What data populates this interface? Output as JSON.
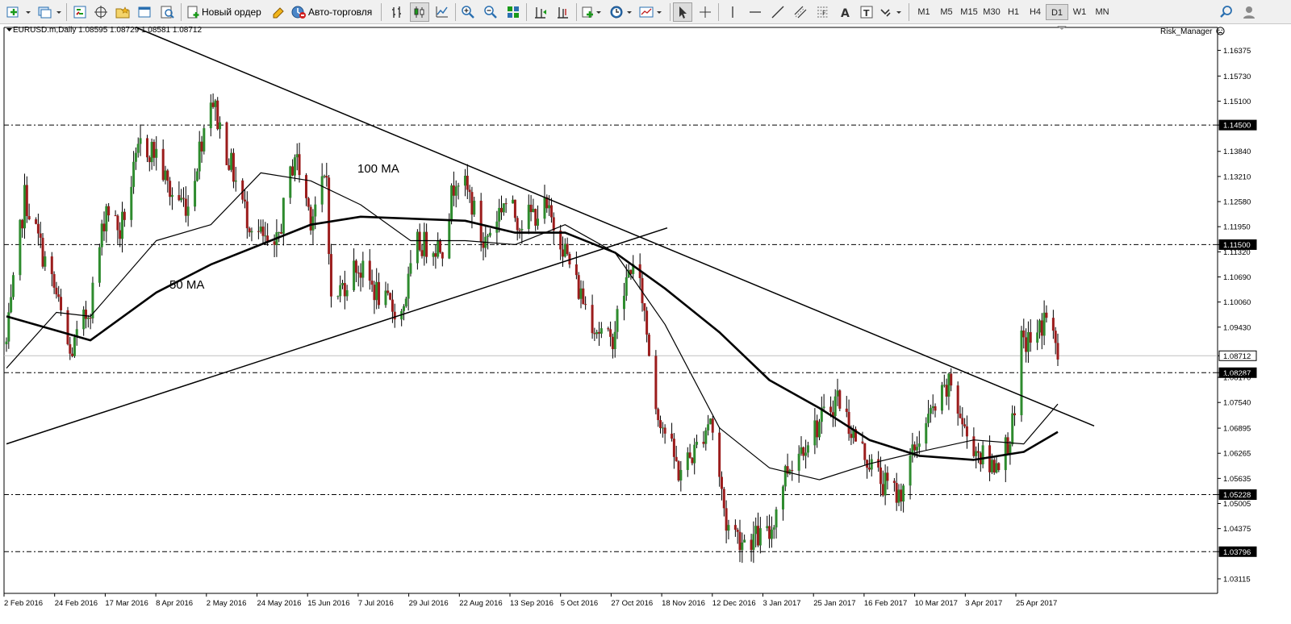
{
  "toolbar": {
    "new_order_label": "Новый ордер",
    "auto_trading_label": "Авто-торговля",
    "timeframes": [
      "M1",
      "M5",
      "M15",
      "M30",
      "H1",
      "H4",
      "D1",
      "W1",
      "MN"
    ],
    "active_timeframe": "D1"
  },
  "chart": {
    "header": "EURUSD.m,Daily  1.08595 1.08729 1.08581 1.08712",
    "expert_label": "Risk_Manager",
    "annotations": {
      "ma100": "100 MA",
      "ma50": "50 MA"
    },
    "price_labels": [
      "1.16375",
      "1.15730",
      "1.15100",
      "1.14500",
      "1.13840",
      "1.13210",
      "1.12580",
      "1.11950",
      "1.11500",
      "1.11320",
      "1.10690",
      "1.10060",
      "1.09430",
      "1.08712",
      "1.08287",
      "1.08170",
      "1.07540",
      "1.06895",
      "1.06265",
      "1.05635",
      "1.05228",
      "1.05005",
      "1.04375",
      "1.03796",
      "1.03115"
    ],
    "date_labels": [
      "2 Feb 2016",
      "24 Feb 2016",
      "17 Mar 2016",
      "8 Apr 2016",
      "2 May 2016",
      "24 May 2016",
      "15 Jun 2016",
      "7 Jul 2016",
      "29 Jul 2016",
      "22 Aug 2016",
      "13 Sep 2016",
      "5 Oct 2016",
      "27 Oct 2016",
      "18 Nov 2016",
      "12 Dec 2016",
      "3 Jan 2017",
      "25 Jan 2017",
      "16 Feb 2017",
      "10 Mar 2017",
      "3 Apr 2017",
      "25 Apr 2017"
    ],
    "colors": {
      "bull": "#2e8b2e",
      "bear": "#9b1c1c",
      "line": "#000000",
      "bid": "#c0c0c0"
    }
  },
  "chart_data": {
    "type": "candlestick",
    "symbol": "EURUSD.m",
    "timeframe": "Daily",
    "ylim": [
      1.0275,
      1.1695
    ],
    "x_range": [
      "2016-02-02",
      "2017-05-10"
    ],
    "horizontal_levels": [
      1.145,
      1.115,
      1.08287,
      1.05228,
      1.03796
    ],
    "current_price": 1.08712,
    "anchors": [
      {
        "date": "2016-02-02",
        "price": 1.09
      },
      {
        "date": "2016-02-10",
        "price": 1.127
      },
      {
        "date": "2016-02-24",
        "price": 1.102
      },
      {
        "date": "2016-03-01",
        "price": 1.087
      },
      {
        "date": "2016-03-10",
        "price": 1.1
      },
      {
        "date": "2016-03-17",
        "price": 1.125
      },
      {
        "date": "2016-03-23",
        "price": 1.118
      },
      {
        "date": "2016-04-01",
        "price": 1.14
      },
      {
        "date": "2016-04-08",
        "price": 1.138
      },
      {
        "date": "2016-04-14",
        "price": 1.128
      },
      {
        "date": "2016-04-22",
        "price": 1.125
      },
      {
        "date": "2016-05-02",
        "price": 1.153
      },
      {
        "date": "2016-05-08",
        "price": 1.14
      },
      {
        "date": "2016-05-18",
        "price": 1.122
      },
      {
        "date": "2016-05-30",
        "price": 1.112
      },
      {
        "date": "2016-06-08",
        "price": 1.138
      },
      {
        "date": "2016-06-15",
        "price": 1.122
      },
      {
        "date": "2016-06-22",
        "price": 1.132
      },
      {
        "date": "2016-06-24",
        "price": 1.1
      },
      {
        "date": "2016-07-05",
        "price": 1.11
      },
      {
        "date": "2016-07-18",
        "price": 1.1
      },
      {
        "date": "2016-07-25",
        "price": 1.098
      },
      {
        "date": "2016-08-01",
        "price": 1.115
      },
      {
        "date": "2016-08-12",
        "price": 1.115
      },
      {
        "date": "2016-08-18",
        "price": 1.133
      },
      {
        "date": "2016-08-24",
        "price": 1.127
      },
      {
        "date": "2016-08-30",
        "price": 1.115
      },
      {
        "date": "2016-09-08",
        "price": 1.126
      },
      {
        "date": "2016-09-15",
        "price": 1.121
      },
      {
        "date": "2016-09-26",
        "price": 1.124
      },
      {
        "date": "2016-10-03",
        "price": 1.117
      },
      {
        "date": "2016-10-10",
        "price": 1.105
      },
      {
        "date": "2016-10-18",
        "price": 1.095
      },
      {
        "date": "2016-10-25",
        "price": 1.09
      },
      {
        "date": "2016-11-03",
        "price": 1.11
      },
      {
        "date": "2016-11-08",
        "price": 1.102
      },
      {
        "date": "2016-11-14",
        "price": 1.075
      },
      {
        "date": "2016-11-24",
        "price": 1.058
      },
      {
        "date": "2016-12-01",
        "price": 1.063
      },
      {
        "date": "2016-12-08",
        "price": 1.072
      },
      {
        "date": "2016-12-15",
        "price": 1.045
      },
      {
        "date": "2016-12-22",
        "price": 1.041
      },
      {
        "date": "2017-01-03",
        "price": 1.042
      },
      {
        "date": "2017-01-10",
        "price": 1.058
      },
      {
        "date": "2017-01-19",
        "price": 1.066
      },
      {
        "date": "2017-01-26",
        "price": 1.071
      },
      {
        "date": "2017-02-02",
        "price": 1.077
      },
      {
        "date": "2017-02-10",
        "price": 1.066
      },
      {
        "date": "2017-02-22",
        "price": 1.055
      },
      {
        "date": "2017-03-01",
        "price": 1.052
      },
      {
        "date": "2017-03-10",
        "price": 1.067
      },
      {
        "date": "2017-03-17",
        "price": 1.074
      },
      {
        "date": "2017-03-24",
        "price": 1.08
      },
      {
        "date": "2017-03-30",
        "price": 1.068
      },
      {
        "date": "2017-04-10",
        "price": 1.059
      },
      {
        "date": "2017-04-17",
        "price": 1.064
      },
      {
        "date": "2017-04-21",
        "price": 1.071
      },
      {
        "date": "2017-04-24",
        "price": 1.09
      },
      {
        "date": "2017-05-01",
        "price": 1.092
      },
      {
        "date": "2017-05-05",
        "price": 1.098
      },
      {
        "date": "2017-05-10",
        "price": 1.087
      }
    ],
    "ma50_anchors": [
      {
        "date": "2016-02-02",
        "price": 1.084
      },
      {
        "date": "2016-02-24",
        "price": 1.098
      },
      {
        "date": "2016-03-10",
        "price": 1.097
      },
      {
        "date": "2016-04-08",
        "price": 1.116
      },
      {
        "date": "2016-05-02",
        "price": 1.12
      },
      {
        "date": "2016-05-24",
        "price": 1.133
      },
      {
        "date": "2016-06-15",
        "price": 1.131
      },
      {
        "date": "2016-07-07",
        "price": 1.125
      },
      {
        "date": "2016-07-29",
        "price": 1.116
      },
      {
        "date": "2016-08-22",
        "price": 1.116
      },
      {
        "date": "2016-09-13",
        "price": 1.115
      },
      {
        "date": "2016-10-05",
        "price": 1.12
      },
      {
        "date": "2016-10-27",
        "price": 1.113
      },
      {
        "date": "2016-11-18",
        "price": 1.095
      },
      {
        "date": "2016-12-12",
        "price": 1.069
      },
      {
        "date": "2017-01-03",
        "price": 1.059
      },
      {
        "date": "2017-01-25",
        "price": 1.056
      },
      {
        "date": "2017-02-16",
        "price": 1.06
      },
      {
        "date": "2017-03-10",
        "price": 1.063
      },
      {
        "date": "2017-04-03",
        "price": 1.066
      },
      {
        "date": "2017-04-25",
        "price": 1.065
      },
      {
        "date": "2017-05-10",
        "price": 1.075
      }
    ],
    "ma100_anchors": [
      {
        "date": "2016-02-02",
        "price": 1.097
      },
      {
        "date": "2016-03-10",
        "price": 1.091
      },
      {
        "date": "2016-04-08",
        "price": 1.103
      },
      {
        "date": "2016-05-02",
        "price": 1.11
      },
      {
        "date": "2016-06-15",
        "price": 1.12
      },
      {
        "date": "2016-07-07",
        "price": 1.122
      },
      {
        "date": "2016-08-22",
        "price": 1.121
      },
      {
        "date": "2016-09-13",
        "price": 1.118
      },
      {
        "date": "2016-10-05",
        "price": 1.118
      },
      {
        "date": "2016-10-27",
        "price": 1.113
      },
      {
        "date": "2016-11-18",
        "price": 1.104
      },
      {
        "date": "2016-12-12",
        "price": 1.093
      },
      {
        "date": "2017-01-03",
        "price": 1.081
      },
      {
        "date": "2017-01-25",
        "price": 1.074
      },
      {
        "date": "2017-02-16",
        "price": 1.066
      },
      {
        "date": "2017-03-10",
        "price": 1.062
      },
      {
        "date": "2017-04-03",
        "price": 1.061
      },
      {
        "date": "2017-04-25",
        "price": 1.063
      },
      {
        "date": "2017-05-10",
        "price": 1.068
      }
    ],
    "trendlines": [
      {
        "from": {
          "date": "2016-02-02",
          "price": 1.065
        },
        "to": {
          "date": "2016-11-19",
          "price": 1.1192
        }
      },
      {
        "from": {
          "date": "2016-03-30",
          "price": 1.1695
        },
        "to": {
          "date": "2017-05-26",
          "price": 1.0695
        }
      }
    ]
  }
}
